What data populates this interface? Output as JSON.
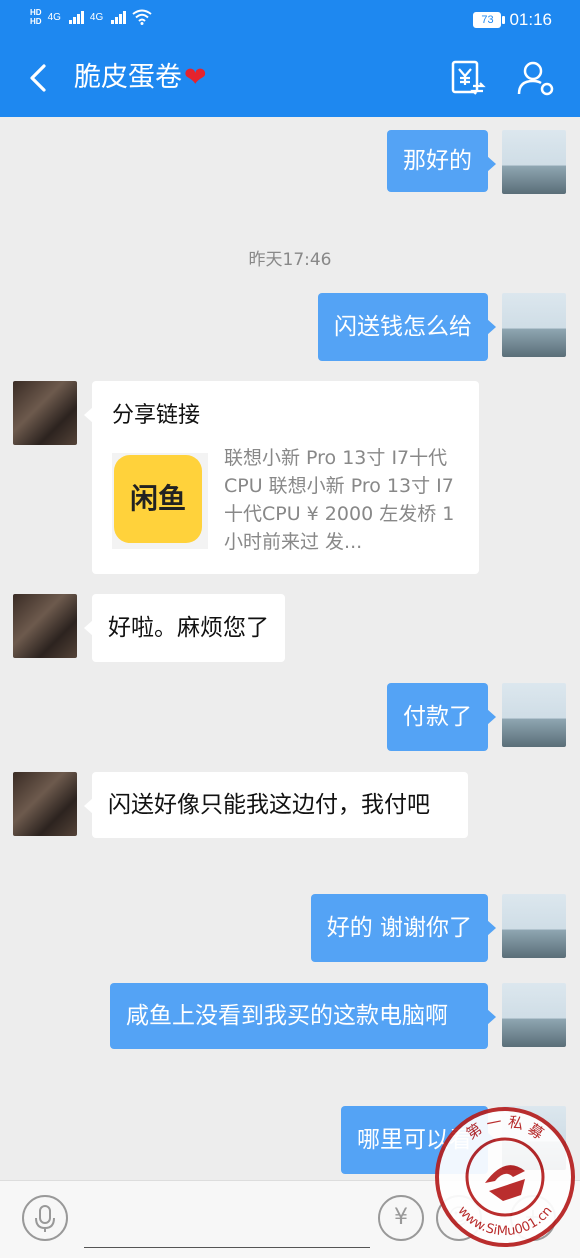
{
  "status": {
    "network1": "4G",
    "network2": "4G",
    "battery": "73",
    "time": "01:16"
  },
  "header": {
    "title": "脆皮蛋卷",
    "heart": "❤",
    "icons": [
      "transfer-money-icon",
      "user-settings-icon"
    ]
  },
  "messages": [
    {
      "from": "me",
      "text": "那好的"
    },
    {
      "type": "time",
      "text": "昨天17:46"
    },
    {
      "from": "me",
      "text": "闪送钱怎么给"
    },
    {
      "from": "her",
      "type": "share",
      "title": "分享链接",
      "app_logo": "闲鱼",
      "description": "联想小新 Pro 13寸 I7十代CPU  联想小新 Pro 13寸 I7十代CPU ¥ 2000 左发桥 1小时前来过 发..."
    },
    {
      "from": "her",
      "text": "好啦。麻烦您了"
    },
    {
      "from": "me",
      "text": "付款了"
    },
    {
      "from": "her",
      "text": "闪送好像只能我这边付，我付吧"
    },
    {
      "from": "me",
      "text": "好的 谢谢你了"
    },
    {
      "from": "me",
      "text": "咸鱼上没看到我买的这款电脑啊"
    },
    {
      "from": "me",
      "text": "哪里可以看"
    }
  ],
  "input_bar": {
    "placeholder": "",
    "icons": [
      "voice-icon",
      "red-packet-icon",
      "emoji-icon",
      "plus-icon"
    ]
  },
  "watermark": {
    "top_text": "第 一 私 募",
    "bottom_text": "www.SiMu001.cn"
  }
}
